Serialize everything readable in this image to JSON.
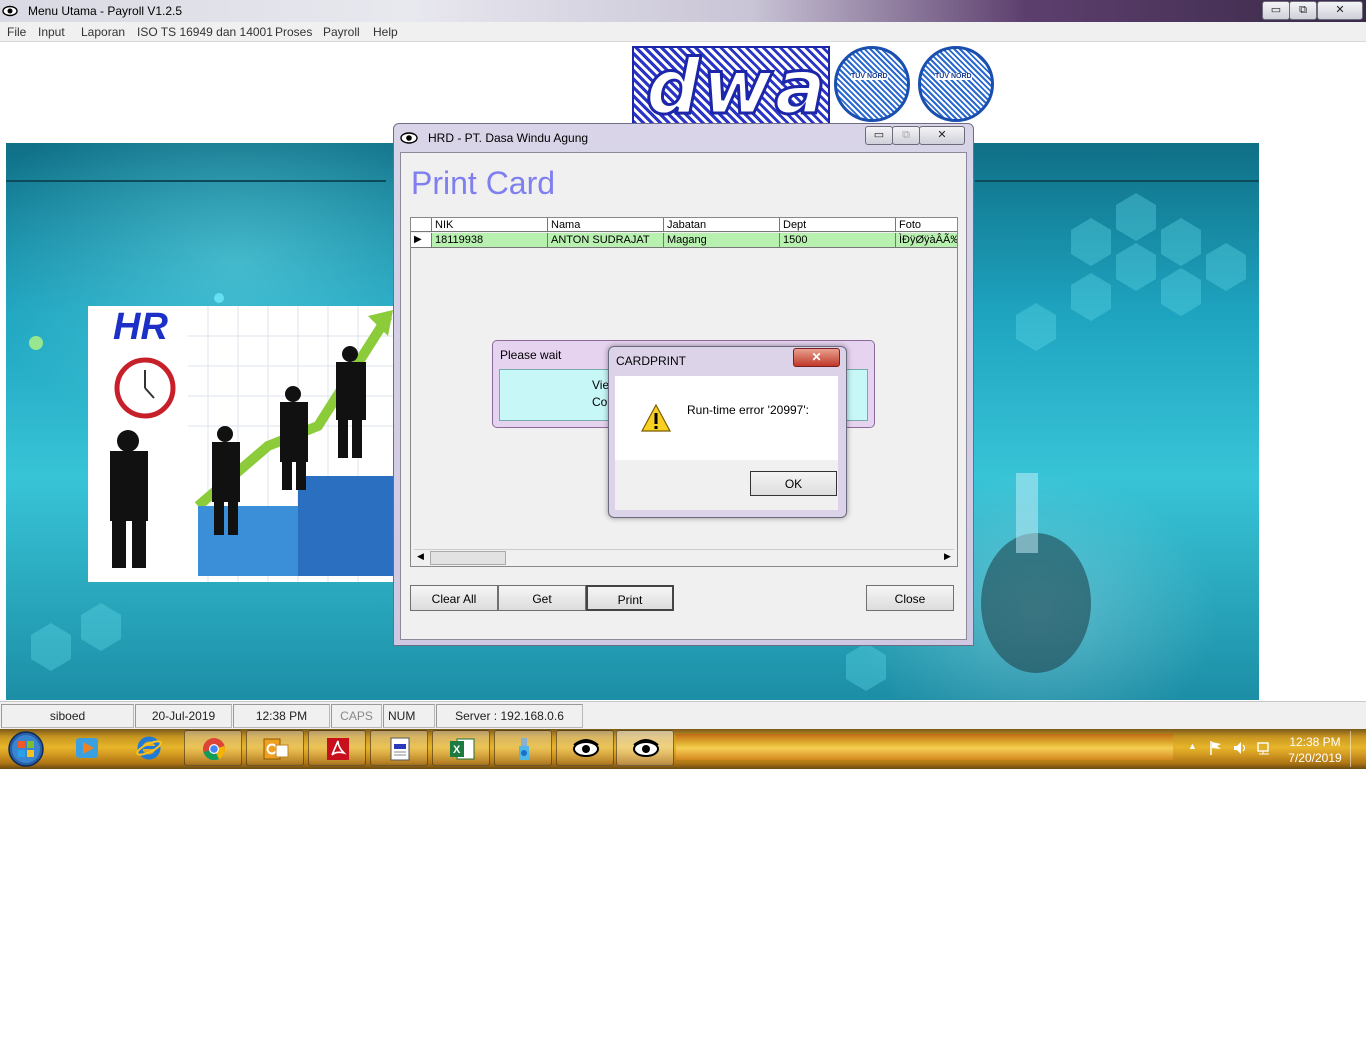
{
  "window": {
    "title": "Menu Utama - Payroll V1.2.5",
    "min_label": "▭",
    "max_label": "⧉",
    "close_label": "✕"
  },
  "menu": [
    "File",
    "Input",
    "Laporan",
    "ISO TS 16949 dan 14001",
    "Proses",
    "Payroll",
    "Help"
  ],
  "header": {
    "logo_text": "dwa",
    "cert1": "TÜV NORD",
    "cert2": "TÜV NORD"
  },
  "hr_image": {
    "label": "HR"
  },
  "hrd_window": {
    "title": "HRD - PT. Dasa Windu Agung",
    "heading": "Print Card",
    "columns": [
      "NIK",
      "Nama",
      "Jabatan",
      "Dept",
      "Foto"
    ],
    "rows": [
      {
        "nik": "18119938",
        "nama": "ANTON SUDRAJAT",
        "jabatan": "Magang",
        "dept": "1500",
        "foto": "ÌÐÿØÿàÂÃ‰¤ÿ"
      }
    ],
    "buttons": {
      "clear_all": "Clear All",
      "get": "Get",
      "print": "Print",
      "close": "Close"
    }
  },
  "please_wait": {
    "title": "Please wait",
    "line1": "Vie",
    "line2": "Cor"
  },
  "msgbox": {
    "title": "CARDPRINT",
    "close_label": "✕",
    "message": "Run-time error '20997':",
    "ok_label": "OK"
  },
  "statusbar": {
    "user": "siboed",
    "date": "20-Jul-2019",
    "time": "12:38 PM",
    "caps": "CAPS",
    "num": "NUM",
    "server": "Server : 192.168.0.6"
  },
  "taskbar": {
    "icons": [
      "windows-start",
      "media-player",
      "internet-explorer",
      "chrome",
      "outlook",
      "acrobat-reader",
      "notepad-document",
      "excel",
      "app-installer",
      "eye-app",
      "eye-app-active"
    ],
    "clock_time": "12:38 PM",
    "clock_date": "7/20/2019"
  }
}
